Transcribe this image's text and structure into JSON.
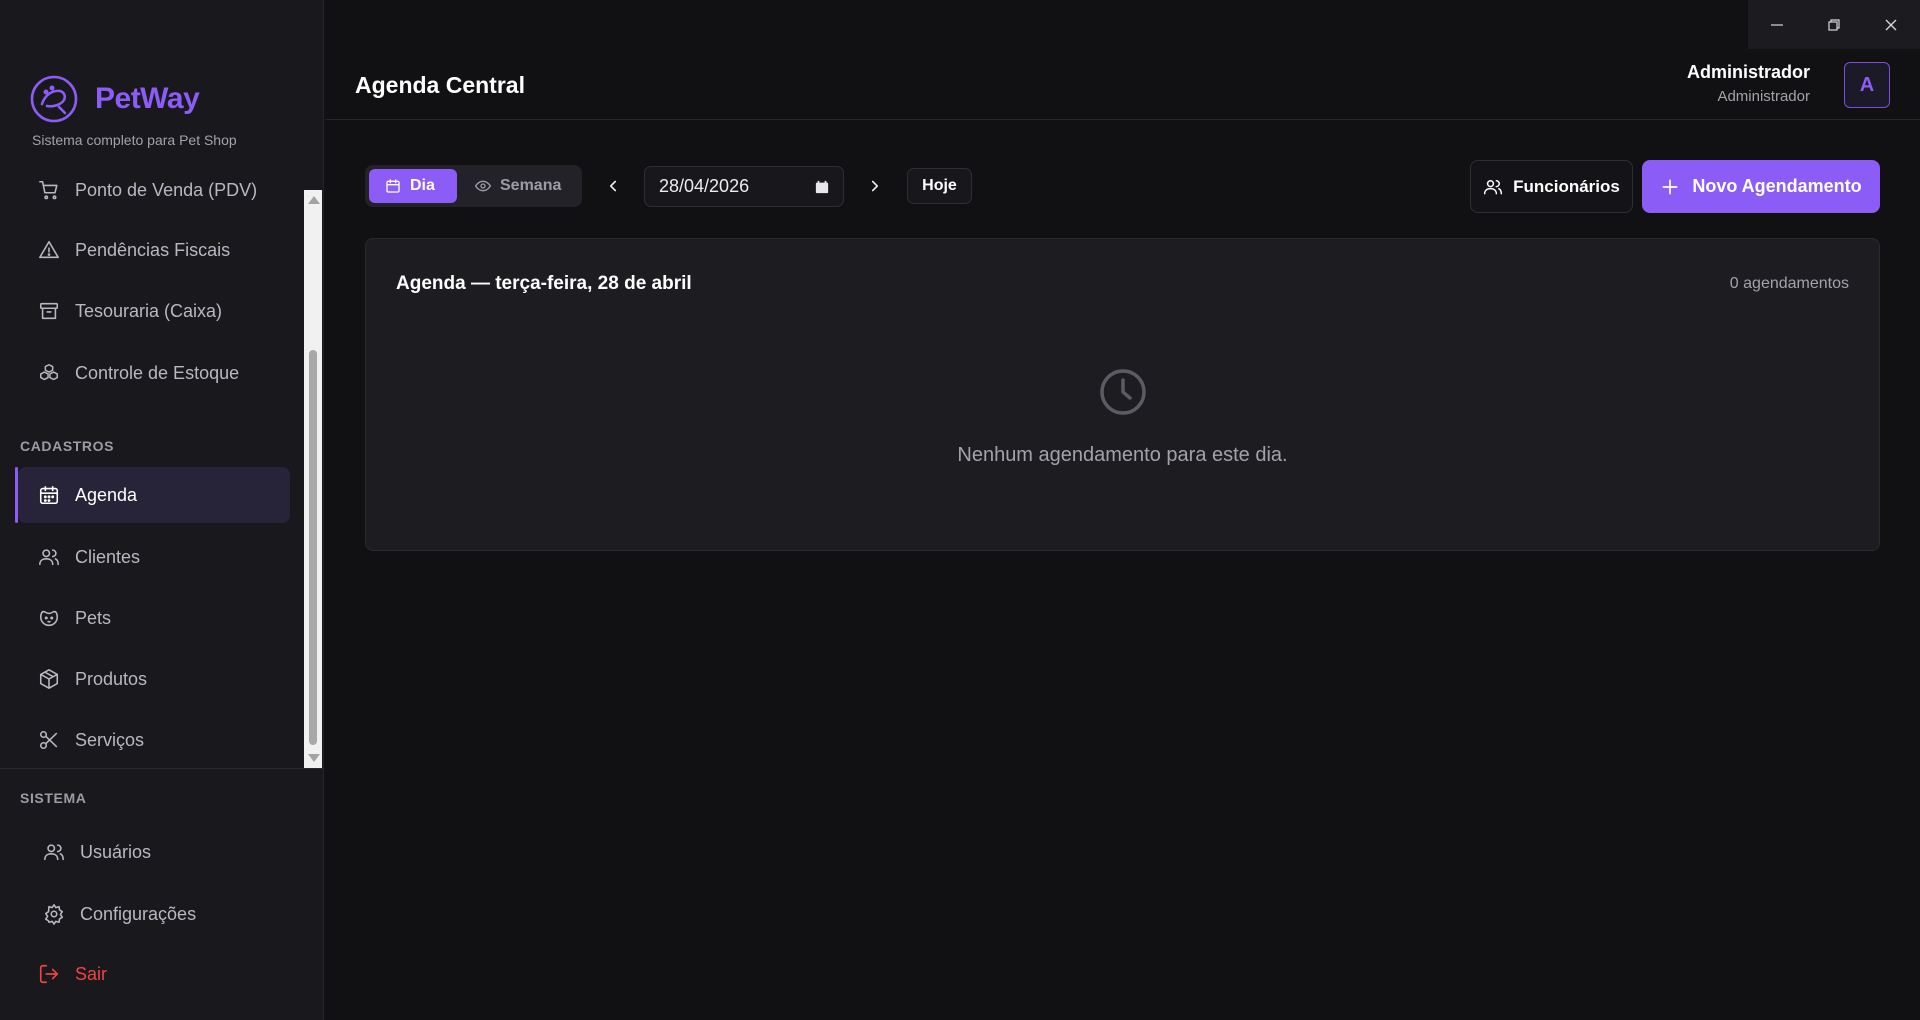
{
  "window": {
    "minimize_icon": "minimize-icon",
    "restore_icon": "restore-icon",
    "close_icon": "close-icon"
  },
  "brand": {
    "name": "PetWay",
    "subtitle": "Sistema completo para Pet Shop",
    "color": "#8b5cf6"
  },
  "sidebar": {
    "items_top": [
      {
        "label": "Ponto de Venda (PDV)",
        "icon": "cart-icon"
      },
      {
        "label": "Pendências Fiscais",
        "icon": "warning-icon"
      },
      {
        "label": "Tesouraria (Caixa)",
        "icon": "archive-icon"
      },
      {
        "label": "Controle de Estoque",
        "icon": "boxes-icon"
      }
    ],
    "section_cadastros": "CADASTROS",
    "items_cadastros": [
      {
        "label": "Agenda",
        "icon": "calendar-icon",
        "active": true
      },
      {
        "label": "Clientes",
        "icon": "users-icon"
      },
      {
        "label": "Pets",
        "icon": "paw-icon"
      },
      {
        "label": "Produtos",
        "icon": "package-icon"
      },
      {
        "label": "Serviços",
        "icon": "scissors-icon"
      }
    ],
    "section_sistema": "SISTEMA",
    "items_sistema": [
      {
        "label": "Usuários",
        "icon": "users-icon"
      },
      {
        "label": "Configurações",
        "icon": "gear-icon"
      }
    ],
    "logout": {
      "label": "Sair",
      "icon": "logout-icon",
      "color": "#ef4444"
    }
  },
  "header": {
    "title": "Agenda Central",
    "user_name": "Administrador",
    "user_role": "Administrador",
    "avatar_letter": "A"
  },
  "toolbar": {
    "view_day": "Dia",
    "view_week": "Semana",
    "date_value": "28/04/2026",
    "today_label": "Hoje",
    "staff_label": "Funcionários",
    "new_label": "Novo Agendamento"
  },
  "agenda": {
    "title": "Agenda — terça-feira, 28 de abril",
    "count": "0 agendamentos",
    "empty_message": "Nenhum agendamento para este dia.",
    "empty_icon": "clock-icon"
  }
}
